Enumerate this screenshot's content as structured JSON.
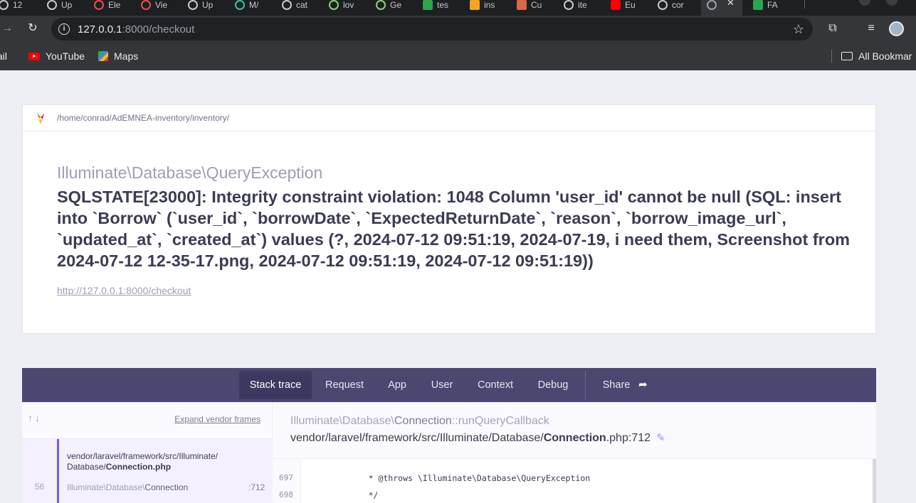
{
  "browser": {
    "tabs": [
      {
        "label": "12"
      },
      {
        "label": "Up"
      },
      {
        "label": "Ele"
      },
      {
        "label": "Vie"
      },
      {
        "label": "Up"
      },
      {
        "label": "M/"
      },
      {
        "label": "cat"
      },
      {
        "label": "lov"
      },
      {
        "label": "Ge"
      },
      {
        "label": "tes"
      },
      {
        "label": "ins"
      },
      {
        "label": "Cu"
      },
      {
        "label": "ite"
      },
      {
        "label": "Eu"
      },
      {
        "label": "cor"
      },
      {
        "label": ""
      },
      {
        "label": "FA"
      }
    ],
    "url_host": "127.0.0.1",
    "url_rest": ":8000/checkout",
    "bookmarks": [
      {
        "label": "ail",
        "icon": "gmail-icon"
      },
      {
        "label": "YouTube",
        "icon": "youtube-icon"
      },
      {
        "label": "Maps",
        "icon": "maps-icon"
      }
    ],
    "all_bookmarks": "All Bookmar"
  },
  "error_page": {
    "app_path": "/home/conrad/AdEMNEA-inventory/inventory/",
    "exception_class": "Illuminate\\Database\\QueryException",
    "exception_message": "SQLSTATE[23000]: Integrity constraint violation: 1048 Column 'user_id' cannot be null (SQL: insert into `Borrow` (`user_id`, `borrowDate`, `ExpectedReturnDate`, `reason`, `borrow_image_url`, `updated_at`, `created_at`) values (?, 2024-07-12 09:51:19, 2024-07-19, i need them, Screenshot from 2024-07-12 12-35-17.png, 2024-07-12 09:51:19, 2024-07-12 09:51:19))",
    "request_url": "http://127.0.0.1:8000/checkout"
  },
  "nav_tabs": {
    "stack_trace": "Stack trace",
    "request": "Request",
    "app": "App",
    "user": "User",
    "context": "Context",
    "debug": "Debug",
    "share": "Share"
  },
  "stack": {
    "expand_vendor": "Expand vendor frames",
    "frame": {
      "number": "56",
      "file_dir": "vendor/laravel/framework/src/Illuminate/",
      "file_sub": "Database/",
      "file_name": "Connection.php",
      "class_prefix": "Illuminate\\Database\\",
      "class_name": "Connection",
      "line": ":712"
    },
    "selected": {
      "class_prefix": "Illuminate\\Database\\",
      "class_name": "Connection",
      "method": "::runQueryCallback",
      "file_dir": "vendor/laravel/framework/src/Illuminate/Database/",
      "file_name": "Connection",
      "file_ext": ".php:712"
    },
    "code_lines": [
      {
        "number": "697",
        "text": "     * @throws \\Illuminate\\Database\\QueryException"
      },
      {
        "number": "698",
        "text": "     */"
      }
    ]
  },
  "colors": {
    "nav_background": "#4a4870",
    "accent": "#7c5bd6"
  }
}
